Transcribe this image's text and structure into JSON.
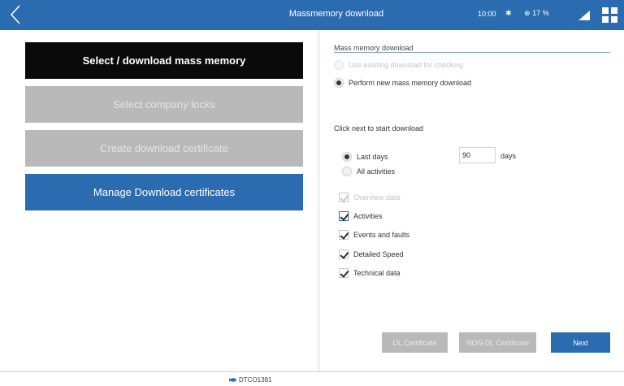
{
  "header": {
    "title": "Massmemory download",
    "time": "10:00",
    "bluetooth": "✱",
    "battery": "17 %",
    "icons": {
      "back": "back-arrow-icon",
      "signal": "signal-icon",
      "apps": "apps-grid-icon",
      "battery": "battery-icon"
    }
  },
  "menu": {
    "items": [
      {
        "label": "Select / download mass memory",
        "state": "active"
      },
      {
        "label": "Select company locks",
        "state": "disabled"
      },
      {
        "label": "Create download certificate",
        "state": "disabled"
      },
      {
        "label": "Manage Download certificates",
        "state": "enabled"
      }
    ]
  },
  "panel": {
    "section_title": "Mass memory download",
    "options": {
      "use_existing": "Use existing download for checking",
      "perform_new": "Perform new mass memory download"
    },
    "instruction": "Click next to start download",
    "range": {
      "last_days_label": "Last days",
      "days_value": "90",
      "days_unit": "days",
      "all_activities_label": "All activities"
    },
    "data_types": [
      {
        "label": "Overview data",
        "checked": true,
        "disabled": true
      },
      {
        "label": "Activities",
        "checked": true,
        "disabled": false
      },
      {
        "label": "Events and faults",
        "checked": true,
        "disabled": false
      },
      {
        "label": "Detailed Speed",
        "checked": true,
        "disabled": false
      },
      {
        "label": "Technical data",
        "checked": true,
        "disabled": false
      }
    ]
  },
  "buttons": {
    "dl_certificate": "DL Certificate",
    "non_dl_certificate": "NON-DL Certificate",
    "next": "Next"
  },
  "footer": {
    "code": "DTCO1381"
  },
  "colors": {
    "accent": "#2b6cb0",
    "active_button": "#0a0a0a",
    "disabled_button": "#b9b9b9"
  }
}
